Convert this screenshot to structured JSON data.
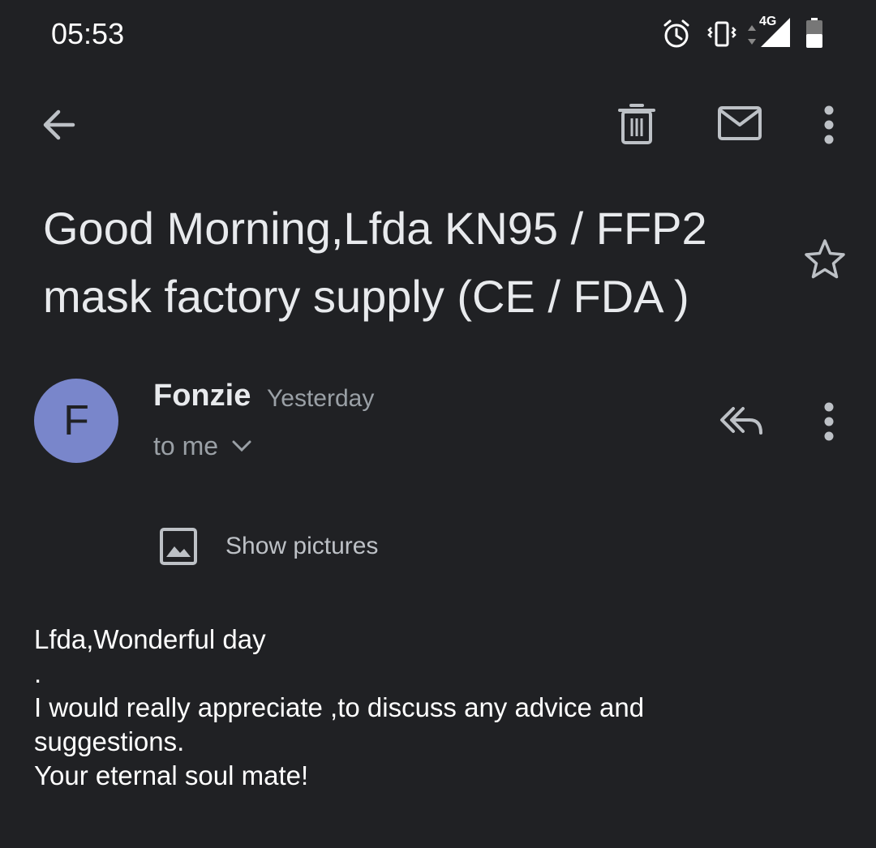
{
  "status_bar": {
    "time": "05:53",
    "network": "4G",
    "icons": [
      "alarm-icon",
      "vibrate-icon",
      "data-arrows-icon",
      "signal-icon",
      "battery-icon"
    ]
  },
  "toolbar": {
    "back_icon": "back-arrow-icon",
    "actions": [
      "delete-icon",
      "mark-unread-icon",
      "more-options-icon"
    ]
  },
  "email": {
    "subject": "Good Morning,Lfda KN95 / FFP2 mask factory supply (CE / FDA )",
    "star_icon": "star-outline-icon",
    "sender": {
      "avatar_letter": "F",
      "avatar_color": "#7986cb",
      "name": "Fonzie",
      "date": "Yesterday",
      "recipient": "to me"
    },
    "show_pictures_label": "Show pictures",
    "body": {
      "line1": "Lfda,Wonderful day",
      "line2": ".",
      "line3": "I would really appreciate ,to discuss any advice and suggestions.",
      "line4": "Your eternal soul mate!"
    }
  },
  "colors": {
    "background": "#202124",
    "text_primary": "#e8eaed",
    "text_secondary": "#9aa0a6",
    "icon": "#bdc1c6"
  }
}
